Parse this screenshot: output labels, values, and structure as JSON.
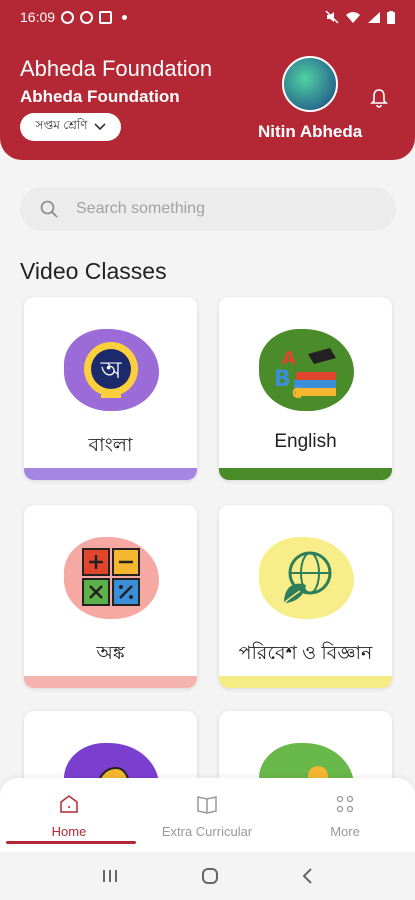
{
  "status_bar": {
    "time": "16:09"
  },
  "header": {
    "org_title": "Abheda Foundation",
    "org_subtitle": "Abheda Foundation",
    "class_select": "সপ্তম শ্রেণি",
    "user_name": "Nitin Abheda"
  },
  "search": {
    "placeholder": "Search something"
  },
  "section_title": "Video Classes",
  "cards": [
    {
      "label": "বাংলা",
      "blob_color": "#9b6bd8",
      "bar_color": "#a587e3",
      "icon": "bengali-letter-icon"
    },
    {
      "label": "English",
      "blob_color": "#4a8b2a",
      "bar_color": "#4a8b2a",
      "icon": "abc-books-icon"
    },
    {
      "label": "অঙ্ক",
      "blob_color": "#f5a9a2",
      "bar_color": "#f5b3ad",
      "icon": "math-operators-icon"
    },
    {
      "label": "পরিবেশ ও বিজ্ঞান",
      "blob_color": "#f7ee8a",
      "bar_color": "#f6ec86",
      "icon": "globe-leaf-icon"
    },
    {
      "label": "",
      "blob_color": "#7b3fd0",
      "bar_color": "#7b3fd0",
      "icon": "warrior-helmet-icon"
    },
    {
      "label": "",
      "blob_color": "#69b84a",
      "bar_color": "#69b84a",
      "icon": "landscape-icon"
    }
  ],
  "nav": {
    "home": "Home",
    "extra": "Extra Curricular",
    "more": "More"
  },
  "colors": {
    "primary": "#b32834"
  }
}
